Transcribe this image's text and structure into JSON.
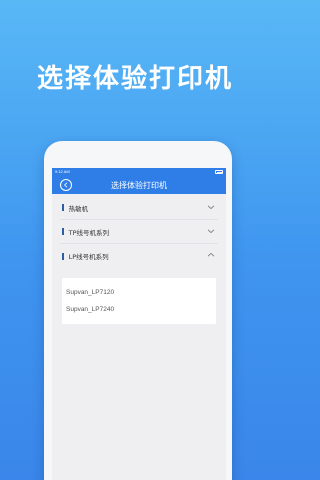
{
  "promo": {
    "title": "选择体验打印机"
  },
  "status": {
    "time": "9:12 AM"
  },
  "nav": {
    "title": "选择体验打印机"
  },
  "sections": [
    {
      "label": "热敏机",
      "expanded": false
    },
    {
      "label": "TP线号机系列",
      "expanded": false
    },
    {
      "label": "LP线号机系列",
      "expanded": true
    }
  ],
  "devices": [
    "Supvan_LP7120",
    "Supvan_LP7240"
  ],
  "colors": {
    "accent": "#2f7ee8",
    "background_top": "#58b8f6",
    "section_bar": "#2b5da8"
  },
  "icons": {
    "back": "back-arrow-icon",
    "collapsed": "chevron-down-icon",
    "expanded": "chevron-up-icon"
  }
}
